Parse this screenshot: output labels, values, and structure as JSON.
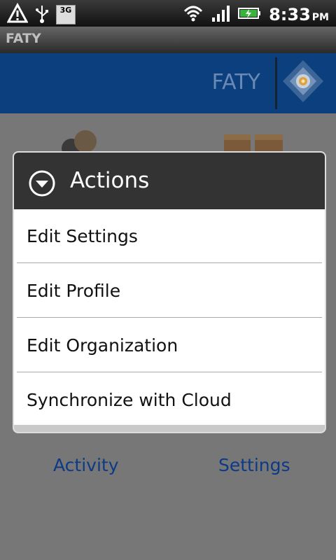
{
  "status_bar": {
    "network_badge": "3G",
    "time": "8:33",
    "ampm": "PM",
    "icons": [
      "warning-icon",
      "usb-icon",
      "3g-icon",
      "wifi-icon",
      "signal-icon",
      "battery-charging-icon"
    ]
  },
  "app": {
    "title": "FATY"
  },
  "header": {
    "brand": "FATY",
    "logo_icon": "faty-logo-icon",
    "background": "#0b3f7e"
  },
  "dialog": {
    "title": "Actions",
    "icon": "chevron-down-circle-icon",
    "items": [
      {
        "label": "Edit Settings"
      },
      {
        "label": "Edit Profile"
      },
      {
        "label": "Edit Organization"
      },
      {
        "label": "Synchronize with Cloud"
      }
    ]
  },
  "background_tiles": {
    "items": [
      {
        "label": "Activity",
        "icon": "people-icon"
      },
      {
        "label": "Settings",
        "icon": "boxes-icon"
      }
    ]
  }
}
